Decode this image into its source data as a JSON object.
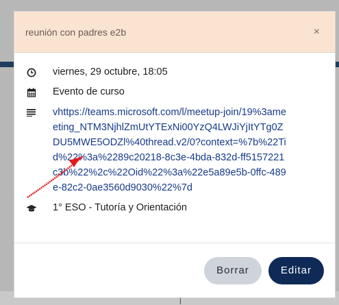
{
  "modal": {
    "title": "reunión con padres e2b",
    "close_label": "×"
  },
  "event": {
    "datetime": "viernes, 29 octubre, 18:05",
    "type": "Evento de curso",
    "description": "vhttps://teams.microsoft.com/l/meetup-join/19%3ameeting_NTM3NjhlZmUtYTExNi00YzQ4LWJiYjItYTg0ZDU5MWE5ODZl%40thread.v2/0?context=%7b%22Tid%22%3a%2289c20218-8c3e-4bda-832d-ff5157221c3b%22%2c%22Oid%22%3a%22e5a89e5b-0ffc-489e-82c2-0ae3560d9030%22%7d",
    "course": "1° ESO - Tutoría y Orientación"
  },
  "footer": {
    "delete_label": "Borrar",
    "edit_label": "Editar"
  },
  "icons": {
    "datetime": "clock-icon",
    "type": "calendar-icon",
    "description": "text-lines-icon",
    "course": "graduation-cap-icon"
  },
  "colors": {
    "header_bg": "#fbe3d2",
    "link": "#163a8a",
    "primary_button": "#0f2a56",
    "secondary_button": "#ced4da",
    "annotation_arrow": "#e21b1b"
  }
}
